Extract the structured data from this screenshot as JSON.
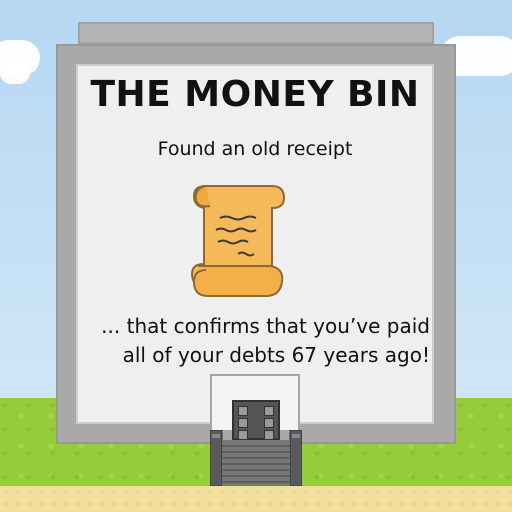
{
  "title": "THE MONEY BIN",
  "event": "Found an old receipt",
  "message_lines": [
    "... that confirms that you’ve paid",
    "all of your debts 67 years ago!"
  ],
  "item_icon": "paper-scroll-icon",
  "colors": {
    "sky": "#b6d7f2",
    "grass": "#96cc3a",
    "sand": "#f2df9c",
    "building": "#a9a9a9",
    "panel": "#efefef",
    "scroll": "#f5b95a",
    "text": "#111111"
  }
}
